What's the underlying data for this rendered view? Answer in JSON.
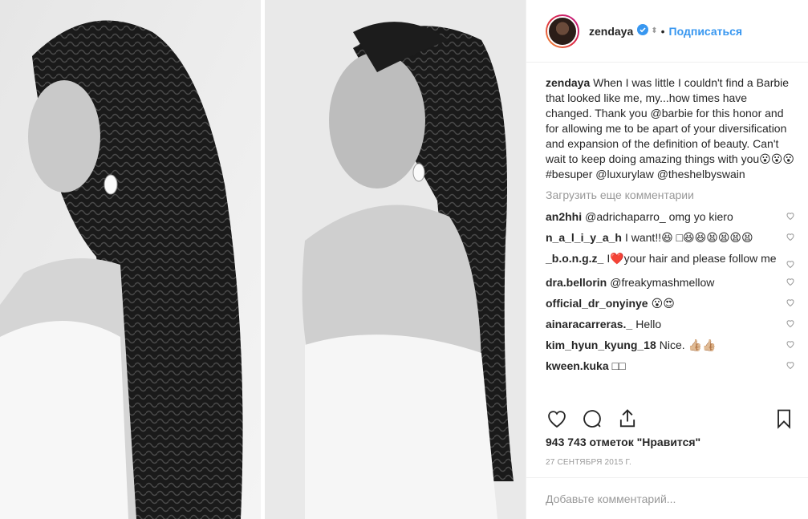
{
  "post": {
    "username": "zendaya",
    "dot": "•",
    "follow_label": "Подписаться",
    "caption_username": "zendaya",
    "caption_text": "When I was little I couldn't find a Barbie that looked like me, my...how times have changed. Thank you @barbie for this honor and for allowing me to be apart of your diversification and expansion of the definition of beauty. Can't wait to keep doing amazing things with you😮😮😮 #besuper @luxurylaw @theshelbyswain",
    "load_more_label": "Загрузить еще комментарии",
    "comments": [
      {
        "user": "an2hhi",
        "text": "@adrichaparro_ omg yo kiero"
      },
      {
        "user": "n_a_l_i_y_a_h",
        "text": "I want!!😆 □😆😆😫😫😫😫"
      },
      {
        "user": "_b.o.n.g.z_",
        "text": "I❤️your hair and please follow me"
      },
      {
        "user": "dra.bellorin",
        "text": "@freakymashmellow"
      },
      {
        "user": "official_dr_onyinye",
        "text": "😮😍"
      },
      {
        "user": "ainaracarreras._",
        "text": "Hello"
      },
      {
        "user": "kim_hyun_kyung_18",
        "text": "Nice. 👍🏼👍🏼"
      },
      {
        "user": "kween.kuka",
        "text": "□□"
      }
    ],
    "likes_label": "943 743 отметок \"Нравится\"",
    "date": "27 СЕНТЯБРЯ 2015 Г.",
    "add_comment_placeholder": "Добавьте комментарий..."
  },
  "icons": [
    "verified-badge-icon",
    "heart-icon",
    "comment-icon",
    "share-icon",
    "bookmark-icon"
  ],
  "colors": {
    "accent": "#3897f0",
    "muted": "#999999",
    "text": "#262626"
  }
}
